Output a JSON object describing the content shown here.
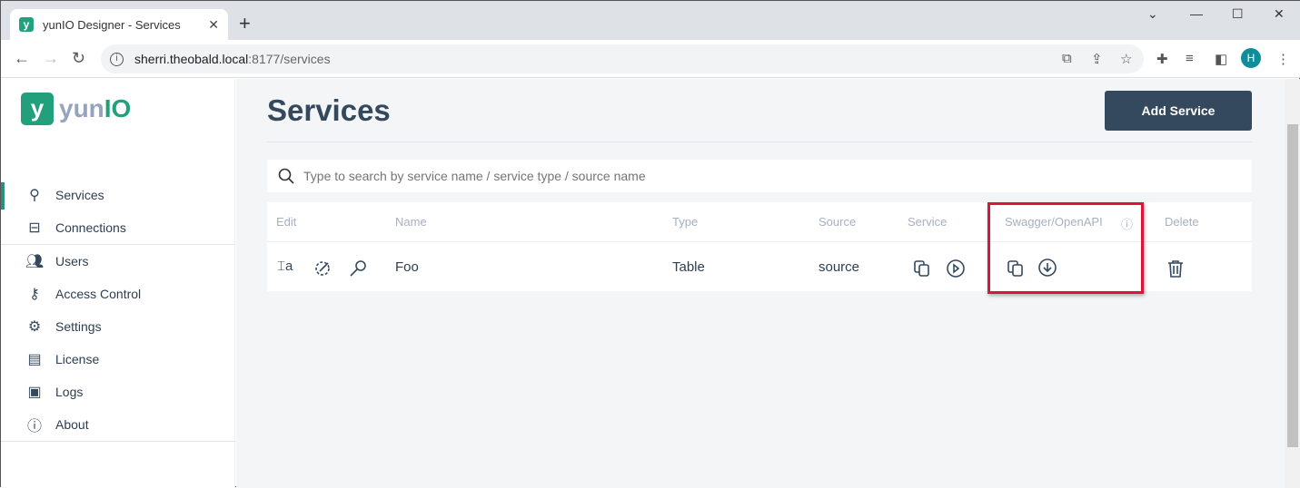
{
  "browser": {
    "tab_title": "yunIO Designer - Services",
    "favicon": "y",
    "url_host": "sherri.theobald.local",
    "url_port_path": ":8177/services",
    "profile_initial": "H"
  },
  "app": {
    "logo_mark": "y",
    "logo_text_a": "yun",
    "logo_text_b": "IO"
  },
  "sidebar": {
    "items": [
      {
        "label": "Services",
        "icon": "sitemap-icon"
      },
      {
        "label": "Connections",
        "icon": "connection-icon"
      },
      {
        "label": "Users",
        "icon": "users-icon"
      },
      {
        "label": "Access Control",
        "icon": "key-icon"
      },
      {
        "label": "Settings",
        "icon": "gear-icon"
      },
      {
        "label": "License",
        "icon": "id-card-icon"
      },
      {
        "label": "Logs",
        "icon": "log-icon"
      },
      {
        "label": "About",
        "icon": "info-icon"
      }
    ]
  },
  "page": {
    "title": "Services",
    "add_button": "Add Service",
    "search_placeholder": "Type to search by service name / service type / source name"
  },
  "table": {
    "headers": [
      "Edit",
      "Name",
      "Type",
      "Source",
      "Service",
      "Swagger/OpenAPI",
      "Delete"
    ],
    "rows": [
      {
        "name": "Foo",
        "type": "Table",
        "source": "source"
      }
    ]
  },
  "colors": {
    "accent": "#22a07c",
    "primary": "#34495e",
    "highlight": "#dc143c"
  }
}
